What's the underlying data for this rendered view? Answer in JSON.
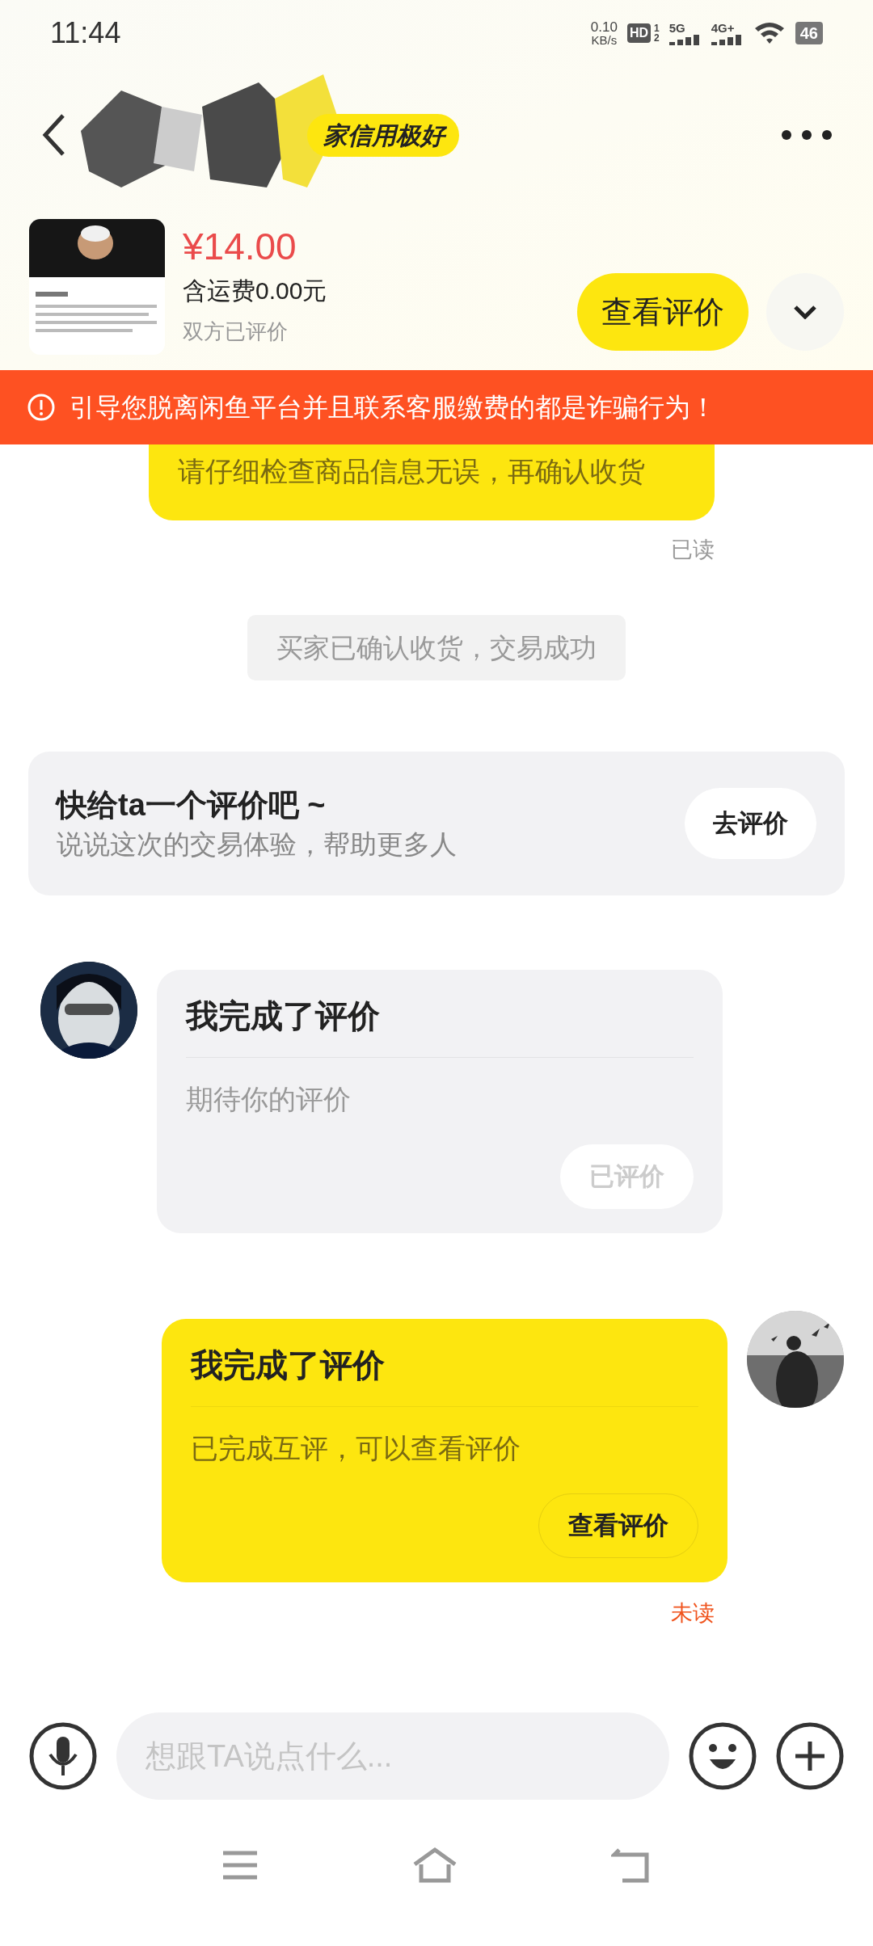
{
  "status_bar": {
    "time": "11:44",
    "net_speed": "0.10",
    "net_unit": "KB/s",
    "hd": "HD",
    "hd_sims": [
      "1",
      "2"
    ],
    "signals": [
      {
        "label": "5G"
      },
      {
        "label": "4G+"
      }
    ],
    "battery": "46"
  },
  "header": {
    "badge": "家信用极好"
  },
  "product": {
    "price": "¥14.00",
    "shipping": "含运费0.00元",
    "status": "双方已评价",
    "button": "查看评价"
  },
  "warning": "引导您脱离闲鱼平台并且联系客服缴费的都是诈骗行为！",
  "messages": [
    {
      "kind": "bubble",
      "text": "请仔细检查商品信息无误，再确认收货",
      "receipt": "已读",
      "read": true
    },
    {
      "kind": "system",
      "text": "买家已确认收货，交易成功"
    },
    {
      "kind": "prompt",
      "title": "快给ta一个评价吧 ~",
      "subtitle": "说说这次的交易体验，帮助更多人",
      "button": "去评价"
    },
    {
      "kind": "card",
      "mine": false,
      "title": "我完成了评价",
      "body": "期待你的评价",
      "button": "已评价",
      "disabled": true
    },
    {
      "kind": "card",
      "mine": true,
      "title": "我完成了评价",
      "body": "已完成互评，可以查看评价",
      "button": "查看评价",
      "disabled": false,
      "receipt": "未读",
      "read": false
    }
  ],
  "input": {
    "placeholder": "想跟TA说点什么..."
  }
}
